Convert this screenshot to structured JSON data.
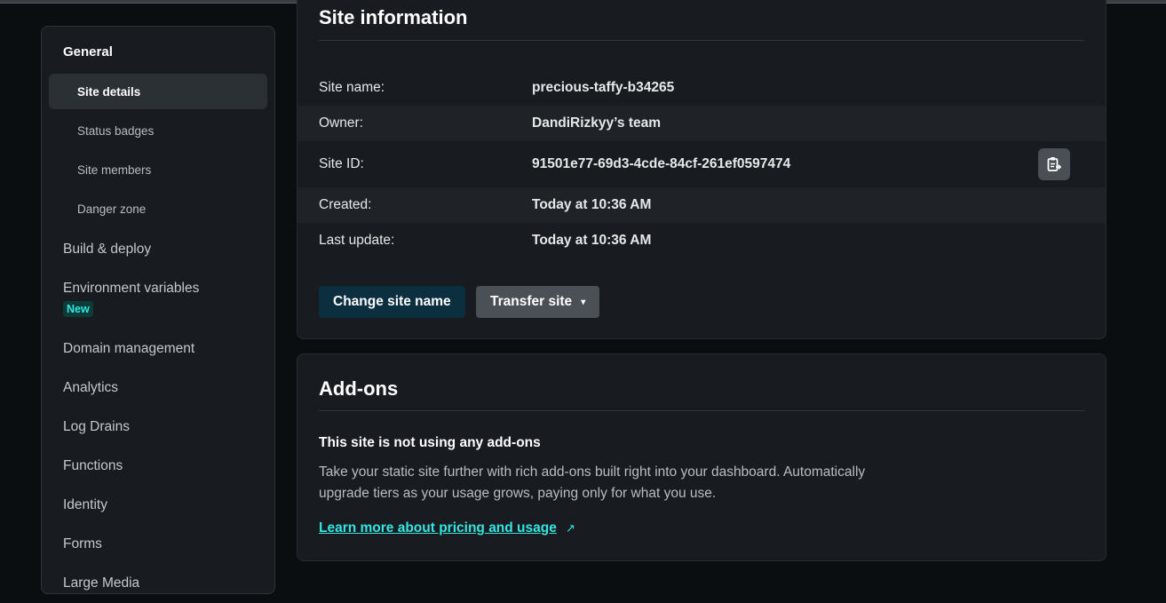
{
  "sidebar": {
    "heading": "General",
    "sub_items": [
      {
        "label": "Site details",
        "active": true
      },
      {
        "label": "Status badges"
      },
      {
        "label": "Site members"
      },
      {
        "label": "Danger zone"
      }
    ],
    "items": [
      {
        "label": "Build & deploy"
      },
      {
        "label": "Environment variables",
        "badge": "New"
      },
      {
        "label": "Domain management"
      },
      {
        "label": "Analytics"
      },
      {
        "label": "Log Drains"
      },
      {
        "label": "Functions"
      },
      {
        "label": "Identity"
      },
      {
        "label": "Forms"
      },
      {
        "label": "Large Media"
      }
    ]
  },
  "site_info": {
    "title": "Site information",
    "rows": [
      {
        "label": "Site name:",
        "value": "precious-taffy-b34265"
      },
      {
        "label": "Owner:",
        "value": "DandiRizkyy’s team"
      },
      {
        "label": "Site ID:",
        "value": "91501e77-69d3-4cde-84cf-261ef0597474"
      },
      {
        "label": "Created:",
        "value": "Today at 10:36 AM"
      },
      {
        "label": "Last update:",
        "value": "Today at 10:36 AM"
      }
    ],
    "copy_icon": "clipboard-copy-icon",
    "change_name_button": "Change site name",
    "transfer_button": "Transfer site",
    "transfer_chevron": "▾"
  },
  "addons": {
    "title": "Add-ons",
    "heading": "This site is not using any add-ons",
    "description": "Take your static site further with rich add-ons built right into your dashboard. Automatically upgrade tiers as your usage grows, paying only for what you use.",
    "link": "Learn more about pricing and usage",
    "link_icon": "↗"
  },
  "colors": {
    "background": "#0b0e11",
    "card": "#181b1f",
    "accent": "#32e6e2",
    "primary_button": "#0c2f3f",
    "secondary_button": "#4b5056"
  }
}
